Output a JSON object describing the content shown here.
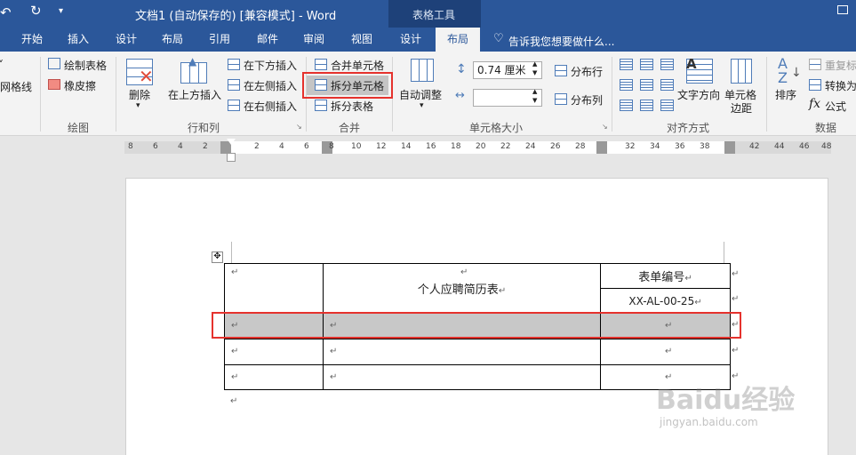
{
  "titlebar": {
    "undo_icon": "undo-icon",
    "redo_icon": "redo-icon",
    "customize_icon": "dropdown-icon",
    "title": "文档1 (自动保存的) [兼容模式] - Word",
    "context_group": "表格工具"
  },
  "tabs": [
    "开始",
    "插入",
    "设计",
    "布局",
    "引用",
    "邮件",
    "审阅",
    "视图",
    "设计",
    "布局"
  ],
  "active_tab": "布局",
  "tellme": "告诉我您想要做什么...",
  "ribbon": {
    "gridlines": "网格线",
    "draw_table": "绘制表格",
    "eraser": "橡皮擦",
    "group_draw": "绘图",
    "delete": "删除",
    "insert_above": "在上方插入",
    "insert_below": "在下方插入",
    "insert_left": "在左侧插入",
    "insert_right": "在右侧插入",
    "group_rows_cols": "行和列",
    "merge_cells": "合并单元格",
    "split_cells": "拆分单元格",
    "split_table": "拆分表格",
    "group_merge": "合并",
    "autofit": "自动调整",
    "height_value": "0.74 厘米",
    "width_value": "",
    "distribute_rows": "分布行",
    "distribute_cols": "分布列",
    "group_cellsize": "单元格大小",
    "text_direction": "文字方向",
    "cell_margins": "单元格边距",
    "group_align": "对齐方式",
    "sort": "排序",
    "repeat_header": "重复标",
    "convert": "转换为",
    "formula": "公式",
    "group_data": "数据"
  },
  "ruler": [
    "8",
    "6",
    "4",
    "2",
    "2",
    "4",
    "6",
    "8",
    "10",
    "12",
    "14",
    "16",
    "18",
    "20",
    "22",
    "24",
    "26",
    "28",
    "32",
    "34",
    "36",
    "38",
    "42",
    "44",
    "46",
    "48"
  ],
  "table": {
    "title": "个人应聘简历表",
    "form_no_label": "表单编号",
    "form_no_value": "XX-AL-00-25"
  },
  "para_mark": "↵",
  "watermark": "Baidu经验",
  "watermark_url": "jingyan.baidu.com",
  "colors": {
    "word_blue": "#2b579a",
    "highlight_red": "#e5322d",
    "selection_gray": "#c8c8c8"
  }
}
